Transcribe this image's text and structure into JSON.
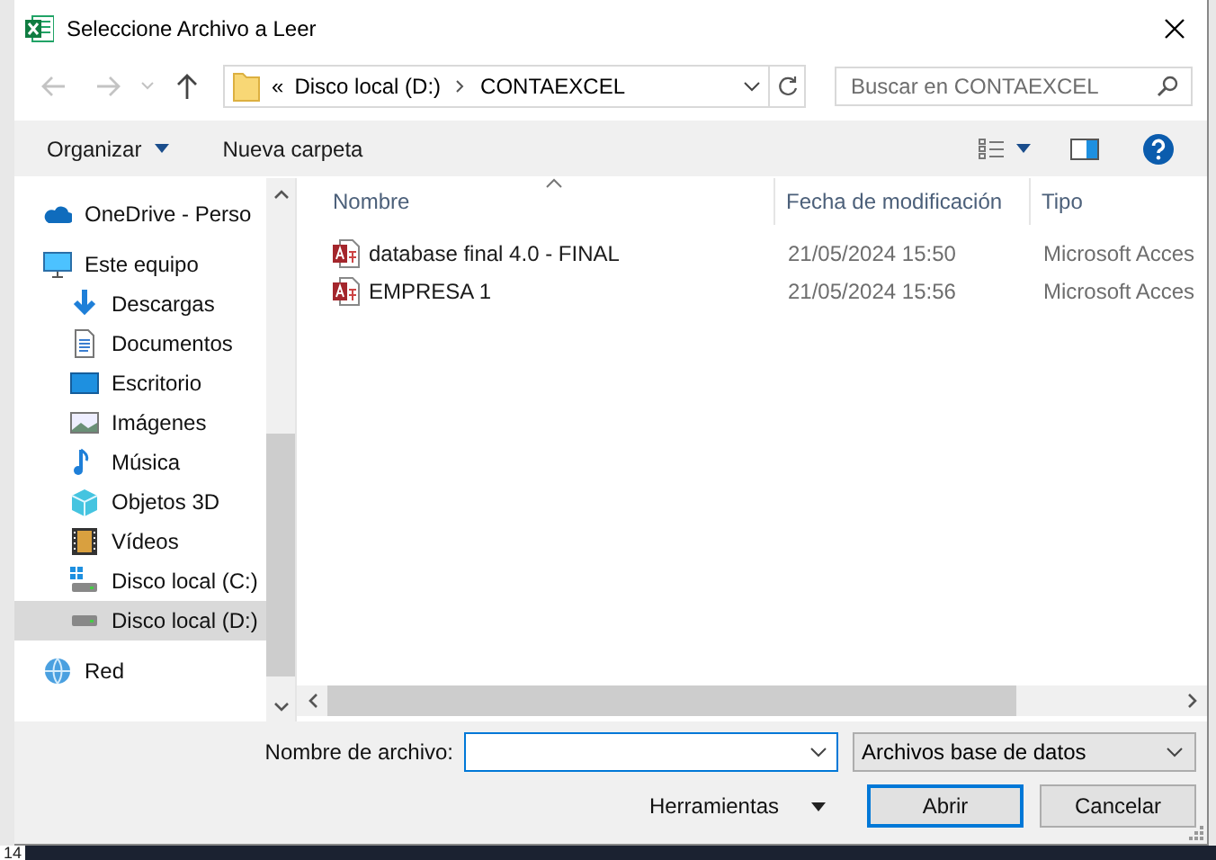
{
  "background": {
    "row_number": "14"
  },
  "window": {
    "title": "Seleccione Archivo a Leer"
  },
  "address_bar": {
    "overflow": "«",
    "path": [
      {
        "label": "Disco local (D:)"
      },
      {
        "label": "CONTAEXCEL"
      }
    ]
  },
  "search": {
    "placeholder": "Buscar en CONTAEXCEL"
  },
  "toolbar": {
    "organize": "Organizar",
    "new_folder": "Nueva carpeta"
  },
  "sidebar": {
    "items": [
      {
        "label": "OneDrive - Perso",
        "kind": "cloud",
        "selected": false
      },
      {
        "label": "Este equipo",
        "kind": "computer",
        "selected": false,
        "children": [
          {
            "label": "Descargas",
            "kind": "download",
            "selected": false
          },
          {
            "label": "Documentos",
            "kind": "document",
            "selected": false
          },
          {
            "label": "Escritorio",
            "kind": "desktop",
            "selected": false
          },
          {
            "label": "Imágenes",
            "kind": "pictures",
            "selected": false
          },
          {
            "label": "Música",
            "kind": "music",
            "selected": false
          },
          {
            "label": "Objetos 3D",
            "kind": "cube",
            "selected": false
          },
          {
            "label": "Vídeos",
            "kind": "video",
            "selected": false
          },
          {
            "label": "Disco local (C:)",
            "kind": "system_drive",
            "selected": false
          },
          {
            "label": "Disco local (D:)",
            "kind": "drive",
            "selected": true
          }
        ]
      },
      {
        "label": "Red",
        "kind": "network",
        "selected": false
      }
    ]
  },
  "file_list": {
    "columns": [
      "Nombre",
      "Fecha de modificación",
      "Tipo"
    ],
    "rows": [
      {
        "name": "database final 4.0 - FINAL",
        "modified": "21/05/2024 15:50",
        "type": "Microsoft Acces"
      },
      {
        "name": "EMPRESA 1",
        "modified": "21/05/2024 15:56",
        "type": "Microsoft Acces"
      }
    ]
  },
  "footer": {
    "filename_label": "Nombre de archivo:",
    "file_type": "Archivos base de datos",
    "tools": "Herramientas",
    "open": "Abrir",
    "cancel": "Cancelar"
  }
}
